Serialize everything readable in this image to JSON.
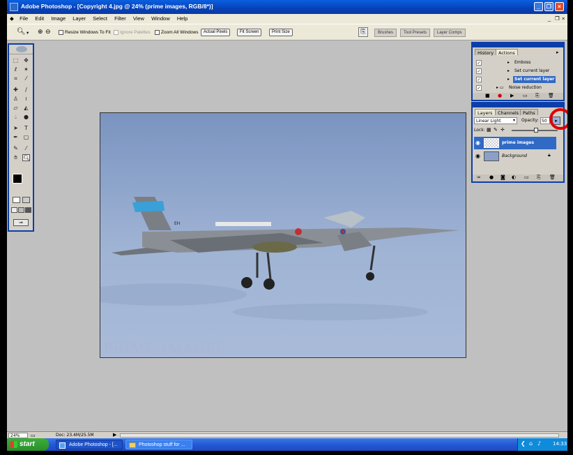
{
  "window": {
    "title": "Adobe Photoshop - [Copyright 4.jpg @ 24% (prime images, RGB/8*)]"
  },
  "menu": [
    "File",
    "Edit",
    "Image",
    "Layer",
    "Select",
    "Filter",
    "View",
    "Window",
    "Help"
  ],
  "options": {
    "resize_windows": "Resize Windows To Fit",
    "ignore_palettes": "Ignore Palettes",
    "zoom_all": "Zoom All Windows",
    "actual_pixels": "Actual Pixels",
    "fit_screen": "Fit Screen",
    "print_size": "Print Size"
  },
  "palette_well": {
    "tabs": [
      "Brushes",
      "Tool Presets",
      "Layer Comps"
    ]
  },
  "history_actions": {
    "tabs": [
      "History",
      "Actions"
    ],
    "rows": [
      "Emboss",
      "Set current layer",
      "Set current layer",
      "Noise reduction"
    ]
  },
  "layers": {
    "tabs": [
      "Layers",
      "Channels",
      "Paths"
    ],
    "blend_mode": "Linear Light",
    "opacity_label": "Opacity:",
    "opacity_value": "50",
    "lock_label": "Lock:",
    "layer_names": [
      "prime images",
      "Background"
    ]
  },
  "document": {
    "watermark": "PRIME IMAGES",
    "tail_code": "EH"
  },
  "status": {
    "zoom": "24%",
    "doc_size": "Doc: 23.4M/25.5M"
  },
  "taskbar": {
    "start": "start",
    "tasks": [
      "Adobe Photoshop - [...",
      "Photoshop stuff for ..."
    ],
    "clock": "14:33"
  },
  "colors": {
    "xp_blue": "#0a5fe0",
    "selected_layer": "#316ac5",
    "highlight_circle": "#e00000"
  }
}
